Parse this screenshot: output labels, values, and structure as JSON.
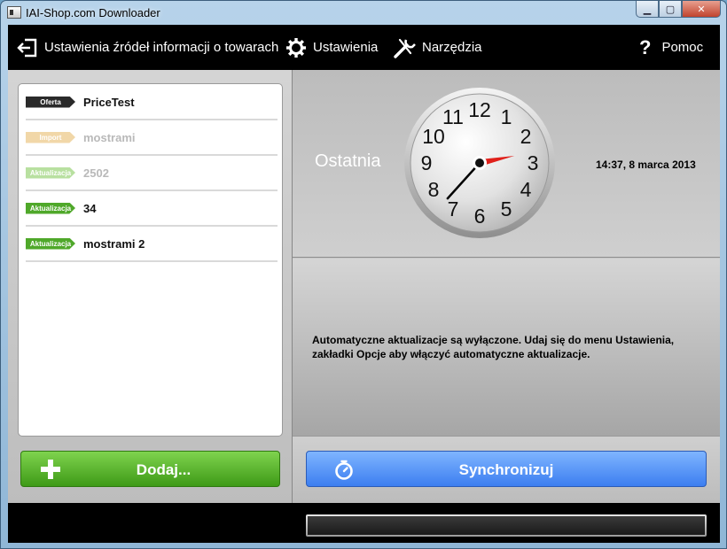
{
  "window": {
    "title": "IAI-Shop.com Downloader"
  },
  "nav": {
    "sources_label": "Ustawienia źródeł informacji o towarach",
    "settings_label": "Ustawienia",
    "tools_label": "Narzędzia",
    "help_label": "Pomoc"
  },
  "sources": {
    "items": [
      {
        "tag": "Oferta",
        "name": "PriceTest",
        "tag_color": "#2a2a2a",
        "dim": false
      },
      {
        "tag": "Import",
        "name": "mostrami",
        "tag_color": "#f1d7a8",
        "dim": true
      },
      {
        "tag": "Aktualizacja",
        "name": "2502",
        "tag_color": "#b8e0a0",
        "dim": true
      },
      {
        "tag": "Aktualizacja",
        "name": "34",
        "tag_color": "#4fa82a",
        "dim": false
      },
      {
        "tag": "Aktualizacja",
        "name": "mostrami 2",
        "tag_color": "#4fa82a",
        "dim": false
      }
    ],
    "add_label": "Dodaj..."
  },
  "last_sync": {
    "label": "Ostatnia",
    "datetime": "14:37, 8 marca 2013",
    "clock": {
      "hour": 14,
      "minute": 37,
      "numerals": [
        "12",
        "1",
        "2",
        "3",
        "4",
        "5",
        "6",
        "7",
        "8",
        "9",
        "10",
        "11"
      ]
    }
  },
  "info": {
    "message": "Automatyczne aktualizacje są wyłączone. Udaj się do menu Ustawienia, zakładki Opcje aby włączyć automatyczne aktualizacje."
  },
  "sync": {
    "label": "Synchronizuj"
  },
  "progress": {
    "value": 0
  },
  "colors": {
    "add_button": "#4fb224",
    "sync_button": "#4f8ff7",
    "clock_hand_second": "#e0201a"
  }
}
